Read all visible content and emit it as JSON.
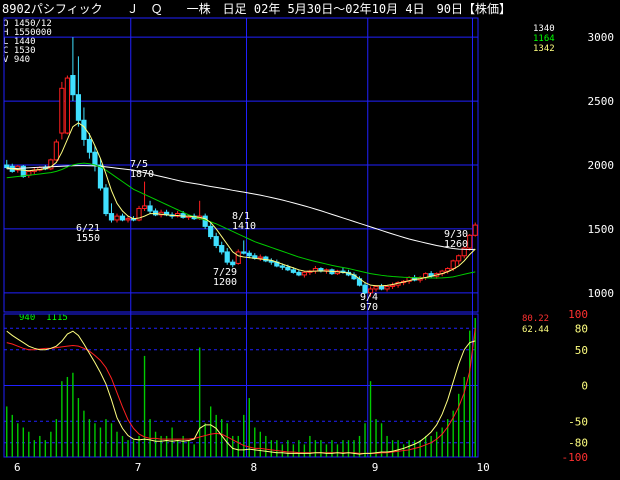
{
  "title": "8902パシフィック　　Ｊ　Ｑ　　一株　日足 02年 5月30日〜02年10月 4日　90日【株価】",
  "ohlc": [
    {
      "k": "O",
      "v": "1450/12"
    },
    {
      "k": "H",
      "v": "1550000"
    },
    {
      "k": "L",
      "v": "1440"
    },
    {
      "k": "C",
      "v": "1530"
    },
    {
      "k": "V",
      "v": "940"
    }
  ],
  "ma_values": [
    {
      "value": "1340",
      "color": "#ffffff"
    },
    {
      "value": "1164",
      "color": "#00ff00"
    },
    {
      "value": "1342",
      "color": "#ffff80"
    }
  ],
  "osc_legend": [
    "940",
    "1115"
  ],
  "osc_values": [
    {
      "value": "80.22",
      "color": "#ff3030"
    },
    {
      "value": "62.44",
      "color": "#ffff80"
    }
  ],
  "colors": {
    "up": "#ff2020",
    "down": "#40e0ff",
    "grid": "#2020ff",
    "ma_short": "#ffff80",
    "ma_mid": "#00cc00",
    "ma_long": "#ffffff",
    "volume": "#00cc00",
    "osc1": "#ffff80",
    "osc2": "#ff2020"
  },
  "annotations": [
    {
      "label": "7/5",
      "price": "1870"
    },
    {
      "label": "6/21",
      "price": "1550"
    },
    {
      "label": "8/1",
      "price": "1410"
    },
    {
      "label": "7/29",
      "price": "1200"
    },
    {
      "label": "9/4",
      "price": "970"
    },
    {
      "label": "9/30",
      "price": "1260"
    }
  ],
  "chart_data": [
    {
      "type": "candlestick",
      "title": "",
      "yticks": [
        1000,
        1500,
        2000,
        2500,
        3000
      ],
      "ylim": [
        850,
        3150
      ],
      "xticks": [
        "6",
        "7",
        "8",
        "9",
        "10"
      ],
      "grid": true,
      "candles": [
        {
          "o": 2000,
          "h": 2040,
          "l": 1970,
          "c": 1980
        },
        {
          "o": 1990,
          "h": 2010,
          "l": 1940,
          "c": 1950
        },
        {
          "o": 1960,
          "h": 2000,
          "l": 1940,
          "c": 1990
        },
        {
          "o": 1990,
          "h": 2000,
          "l": 1900,
          "c": 1910
        },
        {
          "o": 1920,
          "h": 1960,
          "l": 1900,
          "c": 1950
        },
        {
          "o": 1950,
          "h": 1980,
          "l": 1930,
          "c": 1960
        },
        {
          "o": 1960,
          "h": 1990,
          "l": 1950,
          "c": 1980
        },
        {
          "o": 1980,
          "h": 2000,
          "l": 1960,
          "c": 1970
        },
        {
          "o": 1970,
          "h": 2050,
          "l": 1960,
          "c": 2040
        },
        {
          "o": 2040,
          "h": 2200,
          "l": 2030,
          "c": 2180
        },
        {
          "o": 2250,
          "h": 2650,
          "l": 2200,
          "c": 2600
        },
        {
          "o": 2250,
          "h": 2700,
          "l": 2240,
          "c": 2680
        },
        {
          "o": 2700,
          "h": 3000,
          "l": 2500,
          "c": 2550
        },
        {
          "o": 2550,
          "h": 2850,
          "l": 2300,
          "c": 2350
        },
        {
          "o": 2350,
          "h": 2450,
          "l": 2150,
          "c": 2200
        },
        {
          "o": 2200,
          "h": 2250,
          "l": 2050,
          "c": 2100
        },
        {
          "o": 2100,
          "h": 2150,
          "l": 1950,
          "c": 2000
        },
        {
          "o": 2000,
          "h": 2050,
          "l": 1800,
          "c": 1820
        },
        {
          "o": 1820,
          "h": 1850,
          "l": 1600,
          "c": 1620
        },
        {
          "o": 1620,
          "h": 1700,
          "l": 1550,
          "c": 1570
        },
        {
          "o": 1570,
          "h": 1620,
          "l": 1550,
          "c": 1600
        },
        {
          "o": 1600,
          "h": 1620,
          "l": 1560,
          "c": 1570
        },
        {
          "o": 1570,
          "h": 1600,
          "l": 1550,
          "c": 1580
        },
        {
          "o": 1580,
          "h": 1600,
          "l": 1560,
          "c": 1570
        },
        {
          "o": 1570,
          "h": 1680,
          "l": 1560,
          "c": 1660
        },
        {
          "o": 1660,
          "h": 1870,
          "l": 1640,
          "c": 1680
        },
        {
          "o": 1680,
          "h": 1720,
          "l": 1620,
          "c": 1640
        },
        {
          "o": 1640,
          "h": 1660,
          "l": 1600,
          "c": 1610
        },
        {
          "o": 1610,
          "h": 1650,
          "l": 1590,
          "c": 1630
        },
        {
          "o": 1630,
          "h": 1650,
          "l": 1600,
          "c": 1610
        },
        {
          "o": 1610,
          "h": 1630,
          "l": 1580,
          "c": 1600
        },
        {
          "o": 1600,
          "h": 1640,
          "l": 1590,
          "c": 1620
        },
        {
          "o": 1620,
          "h": 1640,
          "l": 1580,
          "c": 1590
        },
        {
          "o": 1590,
          "h": 1610,
          "l": 1570,
          "c": 1600
        },
        {
          "o": 1600,
          "h": 1620,
          "l": 1570,
          "c": 1580
        },
        {
          "o": 1580,
          "h": 1720,
          "l": 1570,
          "c": 1600
        },
        {
          "o": 1600,
          "h": 1620,
          "l": 1500,
          "c": 1520
        },
        {
          "o": 1520,
          "h": 1550,
          "l": 1420,
          "c": 1440
        },
        {
          "o": 1440,
          "h": 1470,
          "l": 1350,
          "c": 1370
        },
        {
          "o": 1370,
          "h": 1400,
          "l": 1300,
          "c": 1320
        },
        {
          "o": 1320,
          "h": 1350,
          "l": 1220,
          "c": 1240
        },
        {
          "o": 1240,
          "h": 1260,
          "l": 1200,
          "c": 1220
        },
        {
          "o": 1230,
          "h": 1340,
          "l": 1220,
          "c": 1320
        },
        {
          "o": 1320,
          "h": 1410,
          "l": 1300,
          "c": 1310
        },
        {
          "o": 1310,
          "h": 1330,
          "l": 1270,
          "c": 1290
        },
        {
          "o": 1290,
          "h": 1310,
          "l": 1260,
          "c": 1270
        },
        {
          "o": 1270,
          "h": 1300,
          "l": 1250,
          "c": 1280
        },
        {
          "o": 1280,
          "h": 1290,
          "l": 1240,
          "c": 1250
        },
        {
          "o": 1250,
          "h": 1270,
          "l": 1220,
          "c": 1240
        },
        {
          "o": 1240,
          "h": 1260,
          "l": 1200,
          "c": 1210
        },
        {
          "o": 1210,
          "h": 1230,
          "l": 1180,
          "c": 1200
        },
        {
          "o": 1200,
          "h": 1220,
          "l": 1170,
          "c": 1180
        },
        {
          "o": 1180,
          "h": 1200,
          "l": 1150,
          "c": 1160
        },
        {
          "o": 1160,
          "h": 1180,
          "l": 1130,
          "c": 1140
        },
        {
          "o": 1140,
          "h": 1170,
          "l": 1120,
          "c": 1160
        },
        {
          "o": 1160,
          "h": 1180,
          "l": 1140,
          "c": 1170
        },
        {
          "o": 1170,
          "h": 1210,
          "l": 1150,
          "c": 1190
        },
        {
          "o": 1190,
          "h": 1200,
          "l": 1160,
          "c": 1170
        },
        {
          "o": 1170,
          "h": 1190,
          "l": 1150,
          "c": 1180
        },
        {
          "o": 1180,
          "h": 1190,
          "l": 1140,
          "c": 1150
        },
        {
          "o": 1150,
          "h": 1180,
          "l": 1140,
          "c": 1170
        },
        {
          "o": 1170,
          "h": 1200,
          "l": 1150,
          "c": 1160
        },
        {
          "o": 1160,
          "h": 1180,
          "l": 1130,
          "c": 1140
        },
        {
          "o": 1140,
          "h": 1160,
          "l": 1100,
          "c": 1110
        },
        {
          "o": 1110,
          "h": 1130,
          "l": 1050,
          "c": 1060
        },
        {
          "o": 1060,
          "h": 1080,
          "l": 990,
          "c": 1000
        },
        {
          "o": 1000,
          "h": 1050,
          "l": 970,
          "c": 1030
        },
        {
          "o": 1030,
          "h": 1060,
          "l": 1010,
          "c": 1050
        },
        {
          "o": 1050,
          "h": 1070,
          "l": 1020,
          "c": 1030
        },
        {
          "o": 1030,
          "h": 1060,
          "l": 1010,
          "c": 1050
        },
        {
          "o": 1050,
          "h": 1080,
          "l": 1030,
          "c": 1060
        },
        {
          "o": 1060,
          "h": 1090,
          "l": 1040,
          "c": 1080
        },
        {
          "o": 1080,
          "h": 1100,
          "l": 1060,
          "c": 1090
        },
        {
          "o": 1090,
          "h": 1130,
          "l": 1070,
          "c": 1120
        },
        {
          "o": 1120,
          "h": 1140,
          "l": 1090,
          "c": 1100
        },
        {
          "o": 1100,
          "h": 1130,
          "l": 1080,
          "c": 1120
        },
        {
          "o": 1120,
          "h": 1160,
          "l": 1100,
          "c": 1150
        },
        {
          "o": 1150,
          "h": 1170,
          "l": 1120,
          "c": 1130
        },
        {
          "o": 1130,
          "h": 1160,
          "l": 1110,
          "c": 1150
        },
        {
          "o": 1150,
          "h": 1180,
          "l": 1130,
          "c": 1170
        },
        {
          "o": 1170,
          "h": 1200,
          "l": 1150,
          "c": 1190
        },
        {
          "o": 1190,
          "h": 1260,
          "l": 1170,
          "c": 1250
        },
        {
          "o": 1250,
          "h": 1300,
          "l": 1220,
          "c": 1290
        },
        {
          "o": 1290,
          "h": 1360,
          "l": 1270,
          "c": 1350
        },
        {
          "o": 1350,
          "h": 1460,
          "l": 1330,
          "c": 1450
        },
        {
          "o": 1450,
          "h": 1550,
          "l": 1440,
          "c": 1530
        }
      ],
      "ma_short": [
        1980,
        1970,
        1965,
        1960,
        1955,
        1960,
        1965,
        1970,
        1985,
        2020,
        2100,
        2200,
        2300,
        2330,
        2300,
        2240,
        2150,
        2050,
        1930,
        1800,
        1700,
        1640,
        1600,
        1580,
        1585,
        1600,
        1620,
        1620,
        1615,
        1610,
        1605,
        1605,
        1600,
        1600,
        1595,
        1590,
        1580,
        1550,
        1500,
        1440,
        1380,
        1320,
        1290,
        1280,
        1275,
        1270,
        1265,
        1260,
        1255,
        1240,
        1225,
        1210,
        1195,
        1180,
        1170,
        1168,
        1170,
        1172,
        1170,
        1168,
        1165,
        1160,
        1155,
        1140,
        1110,
        1080,
        1060,
        1055,
        1055,
        1058,
        1065,
        1075,
        1085,
        1095,
        1105,
        1110,
        1120,
        1130,
        1140,
        1150,
        1165,
        1185,
        1210,
        1250,
        1300,
        1342
      ],
      "ma_mid": [
        1900,
        1905,
        1910,
        1915,
        1920,
        1925,
        1930,
        1935,
        1940,
        1950,
        1965,
        1985,
        2000,
        2010,
        2015,
        2010,
        2000,
        1985,
        1960,
        1930,
        1900,
        1870,
        1840,
        1810,
        1790,
        1770,
        1750,
        1730,
        1710,
        1690,
        1670,
        1650,
        1630,
        1610,
        1595,
        1580,
        1570,
        1555,
        1540,
        1520,
        1500,
        1480,
        1460,
        1440,
        1420,
        1400,
        1385,
        1370,
        1355,
        1340,
        1325,
        1310,
        1295,
        1280,
        1268,
        1256,
        1245,
        1235,
        1225,
        1215,
        1206,
        1198,
        1190,
        1180,
        1170,
        1160,
        1150,
        1143,
        1137,
        1132,
        1128,
        1125,
        1122,
        1120,
        1119,
        1118,
        1117,
        1116,
        1116,
        1117,
        1120,
        1125,
        1135,
        1145,
        1155,
        1164
      ],
      "ma_long": [
        1970,
        1972,
        1974,
        1976,
        1978,
        1980,
        1982,
        1984,
        1986,
        1988,
        1990,
        1992,
        1994,
        1995,
        1995,
        1994,
        1993,
        1990,
        1985,
        1980,
        1975,
        1970,
        1965,
        1960,
        1950,
        1940,
        1930,
        1920,
        1910,
        1900,
        1890,
        1880,
        1870,
        1862,
        1855,
        1848,
        1840,
        1832,
        1825,
        1818,
        1810,
        1802,
        1795,
        1788,
        1780,
        1772,
        1764,
        1755,
        1746,
        1736,
        1726,
        1715,
        1704,
        1692,
        1680,
        1668,
        1655,
        1642,
        1628,
        1614,
        1600,
        1586,
        1572,
        1558,
        1544,
        1530,
        1516,
        1502,
        1488,
        1474,
        1460,
        1447,
        1434,
        1421,
        1410,
        1400,
        1390,
        1380,
        1370,
        1362,
        1354,
        1347,
        1342,
        1340,
        1339,
        1340
      ],
      "volume": [
        60,
        50,
        40,
        35,
        30,
        20,
        25,
        20,
        30,
        45,
        90,
        95,
        100,
        70,
        55,
        45,
        40,
        35,
        45,
        40,
        30,
        25,
        20,
        20,
        25,
        120,
        45,
        30,
        25,
        25,
        35,
        20,
        25,
        20,
        15,
        130,
        40,
        60,
        50,
        45,
        40,
        25,
        25,
        50,
        70,
        35,
        30,
        25,
        20,
        20,
        15,
        20,
        15,
        20,
        15,
        25,
        20,
        20,
        15,
        20,
        15,
        20,
        20,
        20,
        25,
        40,
        90,
        45,
        40,
        25,
        20,
        20,
        15,
        20,
        20,
        20,
        25,
        25,
        30,
        35,
        45,
        55,
        75,
        95,
        150,
        165
      ],
      "osc1": [
        76,
        70,
        65,
        60,
        55,
        52,
        50,
        50,
        52,
        55,
        62,
        72,
        76,
        70,
        58,
        45,
        32,
        18,
        2,
        -20,
        -45,
        -60,
        -70,
        -75,
        -76,
        -75,
        -76,
        -78,
        -78,
        -77,
        -78,
        -77,
        -78,
        -77,
        -75,
        -60,
        -55,
        -55,
        -60,
        -70,
        -80,
        -88,
        -90,
        -90,
        -89,
        -90,
        -91,
        -92,
        -93,
        -94,
        -94,
        -95,
        -95,
        -95,
        -95,
        -95,
        -94,
        -94,
        -95,
        -95,
        -94,
        -95,
        -94,
        -95,
        -96,
        -95,
        -95,
        -94,
        -93,
        -93,
        -92,
        -90,
        -88,
        -85,
        -82,
        -78,
        -72,
        -65,
        -55,
        -40,
        -20,
        5,
        30,
        50,
        60,
        62.44
      ],
      "osc2": [
        60,
        58,
        55,
        52,
        50,
        50,
        51,
        52,
        52,
        53,
        54,
        55,
        56,
        55,
        52,
        48,
        42,
        35,
        25,
        10,
        -10,
        -30,
        -48,
        -60,
        -68,
        -72,
        -74,
        -74,
        -75,
        -75,
        -75,
        -75,
        -75,
        -75,
        -74,
        -72,
        -70,
        -68,
        -67,
        -68,
        -72,
        -76,
        -80,
        -84,
        -86,
        -88,
        -88,
        -89,
        -90,
        -91,
        -92,
        -93,
        -93,
        -94,
        -94,
        -94,
        -94,
        -94,
        -94,
        -94,
        -94,
        -94,
        -94,
        -94,
        -95,
        -95,
        -95,
        -95,
        -94,
        -94,
        -93,
        -92,
        -91,
        -90,
        -88,
        -86,
        -83,
        -80,
        -75,
        -68,
        -58,
        -45,
        -30,
        -10,
        20,
        80.22
      ],
      "osc_ylim": [
        -100,
        100
      ],
      "osc_yticks": [
        "100",
        "80",
        "50",
        "0",
        "-50",
        "-80",
        "-100"
      ]
    }
  ]
}
